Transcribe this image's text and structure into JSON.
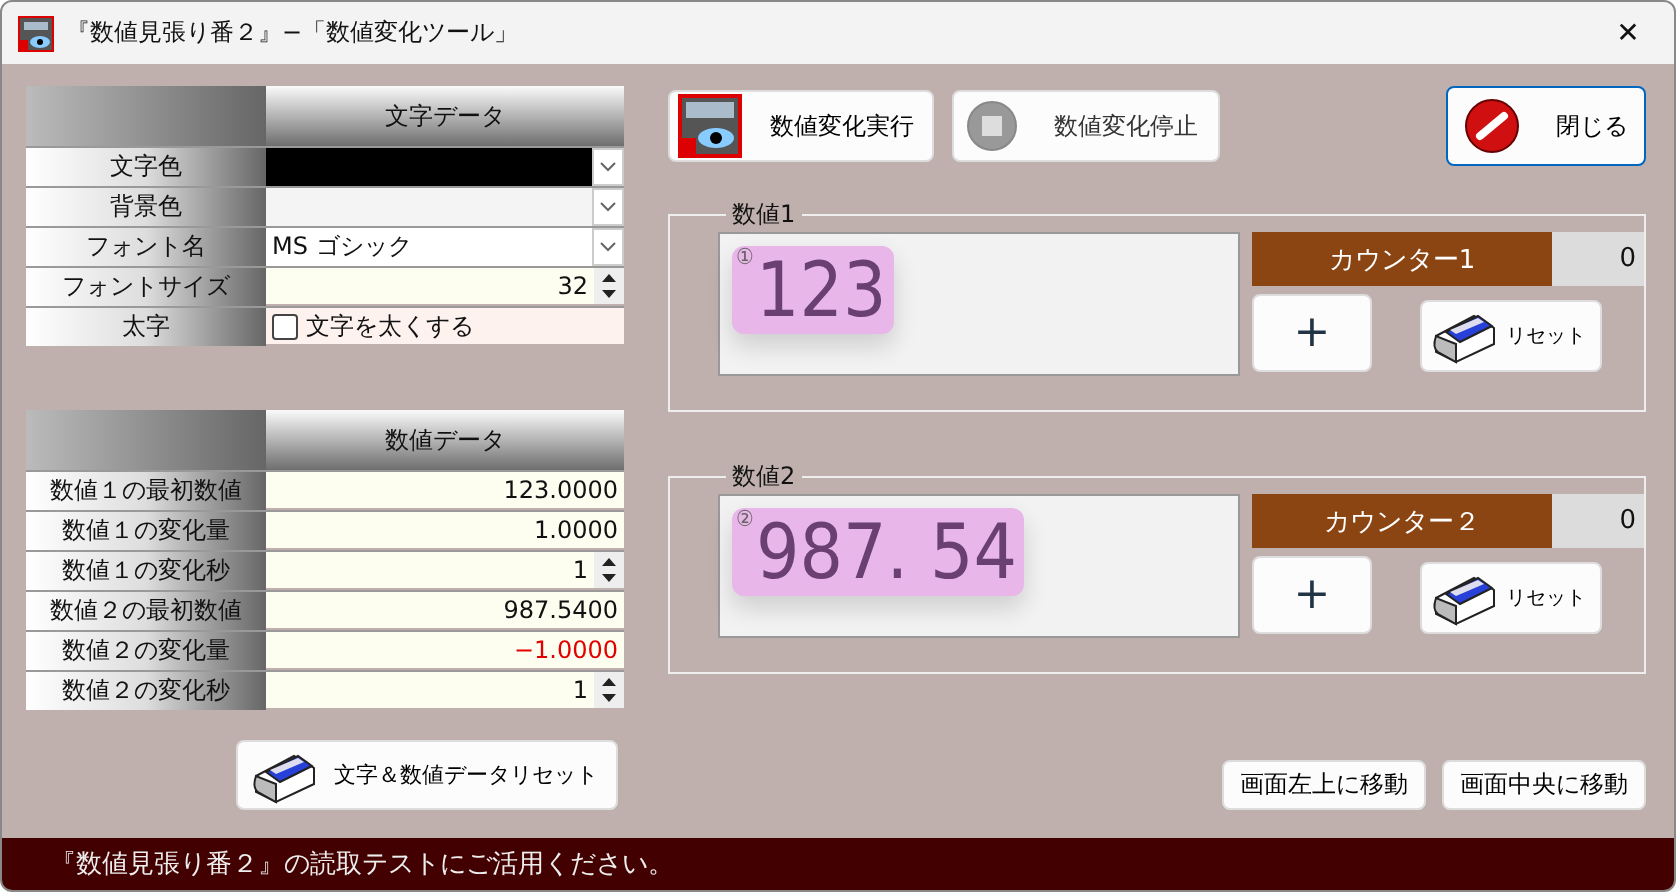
{
  "window": {
    "title": "『数値見張り番２』−「数値変化ツール」",
    "close": "✕"
  },
  "text_table": {
    "header": "文字データ",
    "rows": [
      {
        "label": "文字色",
        "kind": "dropdown",
        "color": "#000000"
      },
      {
        "label": "背景色",
        "kind": "dropdown",
        "color": "#f4f4f4"
      },
      {
        "label": "フォント名",
        "kind": "dropdown",
        "value": "MS ゴシック"
      },
      {
        "label": "フォントサイズ",
        "kind": "spin",
        "value": "32"
      },
      {
        "label": "太字",
        "kind": "checkbox",
        "value": "文字を太くする",
        "checked": false
      }
    ]
  },
  "number_table": {
    "header": "数値データ",
    "rows": [
      {
        "label": "数値１の最初数値",
        "kind": "number",
        "value": "123.0000",
        "negative": false
      },
      {
        "label": "数値１の変化量",
        "kind": "number",
        "value": "1.0000",
        "negative": false
      },
      {
        "label": "数値１の変化秒",
        "kind": "spin",
        "value": "1"
      },
      {
        "label": "数値２の最初数値",
        "kind": "number",
        "value": "987.5400",
        "negative": false
      },
      {
        "label": "数値２の変化量",
        "kind": "number",
        "value": "−1.0000",
        "negative": true
      },
      {
        "label": "数値２の変化秒",
        "kind": "spin",
        "value": "1"
      }
    ]
  },
  "reset_all_button": "文字＆数値データリセット",
  "toolbar": {
    "run": "数値変化実行",
    "stop": "数値変化停止",
    "close": "閉じる"
  },
  "groups": [
    {
      "title": "数値1",
      "badge": "①",
      "value": "123",
      "counter_label": "カウンター1",
      "counter_value": "0",
      "plus": "+",
      "reset": "リセット"
    },
    {
      "title": "数値2",
      "badge": "②",
      "value": "987. 54",
      "counter_label": "カウンター２",
      "counter_value": "0",
      "plus": "+",
      "reset": "リセット"
    }
  ],
  "move_buttons": [
    "画面左上に移動",
    "画面中央に移動"
  ],
  "status_bar": "『数値見張り番２』の読取テストにご活用ください。"
}
